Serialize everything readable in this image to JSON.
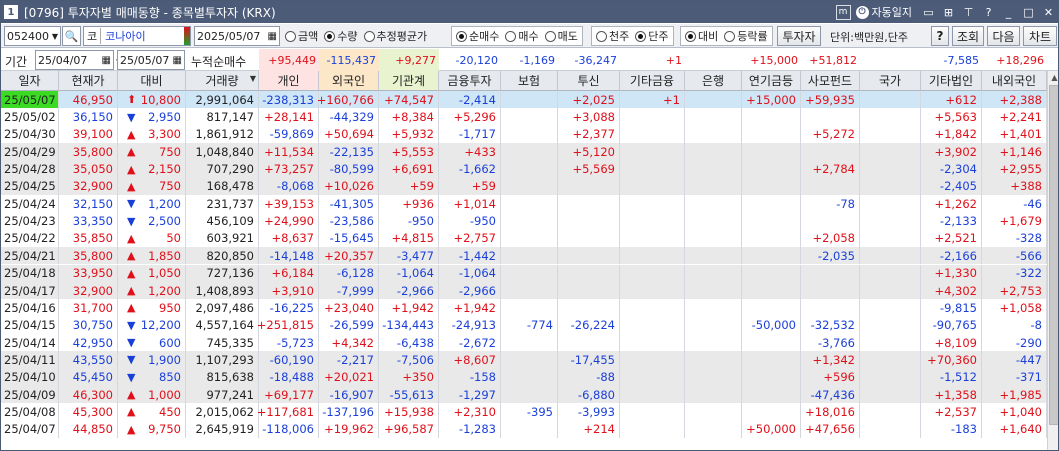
{
  "window": {
    "num": "1",
    "title": "[0796] 투자자별 매매동향 - 종목별투자자 (KRX)",
    "auto_update": "자동일지"
  },
  "toolbar": {
    "code": "052400",
    "market_tag": "코",
    "stock_name": "코나아이",
    "date": "2025/05/07",
    "radio_amount": "금액",
    "radio_qty": "수량",
    "radio_avg": "추정평균가",
    "radio_net": "순매수",
    "radio_buy": "매수",
    "radio_sell": "매도",
    "radio_k1": "천주",
    "radio_unit": "단주",
    "radio_diff": "대비",
    "radio_rate": "등락률",
    "investor_btn": "투자자",
    "unit_label": "단위:백만원,단주",
    "help_btn": "?",
    "query_btn": "조회",
    "next_btn": "다음",
    "chart_btn": "차트"
  },
  "range": {
    "label": "기간",
    "from": "25/04/07",
    "sep": "~",
    "to": "25/05/07",
    "cum_label": "누적순매수",
    "sums": [
      "+95,449",
      "-115,437",
      "+9,277",
      "-20,120",
      "-1,169",
      "-36,247",
      "+1",
      "",
      "+15,000",
      "+51,812",
      "",
      "-7,585",
      "+18,296"
    ]
  },
  "headers": [
    "일자",
    "현재가",
    "대비",
    "거래량",
    "개인",
    "외국인",
    "기관계",
    "금융투자",
    "보험",
    "투신",
    "기타금융",
    "은행",
    "연기금등",
    "사모펀드",
    "국가",
    "기타법인",
    "내외국인"
  ],
  "rows": [
    {
      "date": "25/05/07",
      "price": "46,950",
      "dir": "up",
      "chg": "10,800",
      "vol": "2,991,064",
      "v": [
        "-238,313",
        "+160,766",
        "+74,547",
        "-2,414",
        "",
        "+2,025",
        "+1",
        "",
        "+15,000",
        "+59,935",
        "",
        "+612",
        "+2,388"
      ]
    },
    {
      "date": "25/05/02",
      "price": "36,150",
      "dir": "dn",
      "chg": "2,950",
      "vol": "817,147",
      "v": [
        "+28,141",
        "-44,329",
        "+8,384",
        "+5,296",
        "",
        "+3,088",
        "",
        "",
        "",
        "",
        "",
        "+5,563",
        "+2,241"
      ]
    },
    {
      "date": "25/04/30",
      "price": "39,100",
      "dir": "up",
      "chg": "3,300",
      "vol": "1,861,912",
      "v": [
        "-59,869",
        "+50,694",
        "+5,932",
        "-1,717",
        "",
        "+2,377",
        "",
        "",
        "",
        "+5,272",
        "",
        "+1,842",
        "+1,401"
      ]
    },
    {
      "date": "25/04/29",
      "price": "35,800",
      "dir": "up",
      "chg": "750",
      "vol": "1,048,840",
      "v": [
        "+11,534",
        "-22,135",
        "+5,553",
        "+433",
        "",
        "+5,120",
        "",
        "",
        "",
        "",
        "",
        "+3,902",
        "+1,146"
      ]
    },
    {
      "date": "25/04/28",
      "price": "35,050",
      "dir": "up",
      "chg": "2,150",
      "vol": "707,290",
      "v": [
        "+73,257",
        "-80,599",
        "+6,691",
        "-1,662",
        "",
        "+5,569",
        "",
        "",
        "",
        "+2,784",
        "",
        "-2,304",
        "+2,955"
      ]
    },
    {
      "date": "25/04/25",
      "price": "32,900",
      "dir": "up",
      "chg": "750",
      "vol": "168,478",
      "v": [
        "-8,068",
        "+10,026",
        "+59",
        "+59",
        "",
        "",
        "",
        "",
        "",
        "",
        "",
        "-2,405",
        "+388"
      ]
    },
    {
      "date": "25/04/24",
      "price": "32,150",
      "dir": "dn",
      "chg": "1,200",
      "vol": "231,737",
      "v": [
        "+39,153",
        "-41,305",
        "+936",
        "+1,014",
        "",
        "",
        "",
        "",
        "",
        "-78",
        "",
        "+1,262",
        "-46"
      ]
    },
    {
      "date": "25/04/23",
      "price": "33,350",
      "dir": "dn",
      "chg": "2,500",
      "vol": "456,109",
      "v": [
        "+24,990",
        "-23,586",
        "-950",
        "-950",
        "",
        "",
        "",
        "",
        "",
        "",
        "",
        "-2,133",
        "+1,679"
      ]
    },
    {
      "date": "25/04/22",
      "price": "35,850",
      "dir": "up",
      "chg": "50",
      "vol": "603,921",
      "v": [
        "+8,637",
        "-15,645",
        "+4,815",
        "+2,757",
        "",
        "",
        "",
        "",
        "",
        "+2,058",
        "",
        "+2,521",
        "-328"
      ]
    },
    {
      "date": "25/04/21",
      "price": "35,800",
      "dir": "up",
      "chg": "1,850",
      "vol": "820,850",
      "v": [
        "-14,148",
        "+20,357",
        "-3,477",
        "-1,442",
        "",
        "",
        "",
        "",
        "",
        "-2,035",
        "",
        "-2,166",
        "-566"
      ]
    },
    {
      "date": "25/04/18",
      "price": "33,950",
      "dir": "up",
      "chg": "1,050",
      "vol": "727,136",
      "v": [
        "+6,184",
        "-6,128",
        "-1,064",
        "-1,064",
        "",
        "",
        "",
        "",
        "",
        "",
        "",
        "+1,330",
        "-322"
      ]
    },
    {
      "date": "25/04/17",
      "price": "32,900",
      "dir": "up",
      "chg": "1,200",
      "vol": "1,408,893",
      "v": [
        "+3,910",
        "-7,999",
        "-2,966",
        "-2,966",
        "",
        "",
        "",
        "",
        "",
        "",
        "",
        "+4,302",
        "+2,753"
      ]
    },
    {
      "date": "25/04/16",
      "price": "31,700",
      "dir": "up",
      "chg": "950",
      "vol": "2,097,486",
      "v": [
        "-16,225",
        "+23,040",
        "+1,942",
        "+1,942",
        "",
        "",
        "",
        "",
        "",
        "",
        "",
        "-9,815",
        "+1,058"
      ]
    },
    {
      "date": "25/04/15",
      "price": "30,750",
      "dir": "dn",
      "chg": "12,200",
      "vol": "4,557,164",
      "v": [
        "+251,815",
        "-26,599",
        "-134,443",
        "-24,913",
        "-774",
        "-26,224",
        "",
        "",
        "-50,000",
        "-32,532",
        "",
        "-90,765",
        "-8"
      ]
    },
    {
      "date": "25/04/14",
      "price": "42,950",
      "dir": "dn",
      "chg": "600",
      "vol": "745,335",
      "v": [
        "-5,723",
        "+4,342",
        "-6,438",
        "-2,672",
        "",
        "",
        "",
        "",
        "",
        "-3,766",
        "",
        "+8,109",
        "-290"
      ]
    },
    {
      "date": "25/04/11",
      "price": "43,550",
      "dir": "dn",
      "chg": "1,900",
      "vol": "1,107,293",
      "v": [
        "-60,190",
        "-2,217",
        "-7,506",
        "+8,607",
        "",
        "-17,455",
        "",
        "",
        "",
        "+1,342",
        "",
        "+70,360",
        "-447"
      ]
    },
    {
      "date": "25/04/10",
      "price": "45,450",
      "dir": "dn",
      "chg": "850",
      "vol": "815,638",
      "v": [
        "-18,488",
        "+20,021",
        "+350",
        "-158",
        "",
        "-88",
        "",
        "",
        "",
        "+596",
        "",
        "-1,512",
        "-371"
      ]
    },
    {
      "date": "25/04/09",
      "price": "46,300",
      "dir": "up",
      "chg": "1,000",
      "vol": "977,241",
      "v": [
        "+69,177",
        "-16,907",
        "-55,613",
        "-1,297",
        "",
        "-6,880",
        "",
        "",
        "",
        "-47,436",
        "",
        "+1,358",
        "+1,985"
      ]
    },
    {
      "date": "25/04/08",
      "price": "45,300",
      "dir": "up",
      "chg": "450",
      "vol": "2,015,062",
      "v": [
        "+117,681",
        "-137,196",
        "+15,938",
        "+2,310",
        "-395",
        "-3,993",
        "",
        "",
        "",
        "+18,016",
        "",
        "+2,537",
        "+1,040"
      ]
    },
    {
      "date": "25/04/07",
      "price": "44,850",
      "dir": "up",
      "chg": "9,750",
      "vol": "2,645,919",
      "v": [
        "-118,006",
        "+19,962",
        "+96,587",
        "-1,283",
        "",
        "+214",
        "",
        "",
        "+50,000",
        "+47,656",
        "",
        "-183",
        "+1,640"
      ]
    }
  ],
  "colors": {
    "up": "#e0101a",
    "down": "#1a3fd9",
    "selected_row": "#cfe6f7",
    "alt_row": "#e9e9e9",
    "date_highlight": "#3adb22",
    "header_bg": "#e6e9ee"
  }
}
